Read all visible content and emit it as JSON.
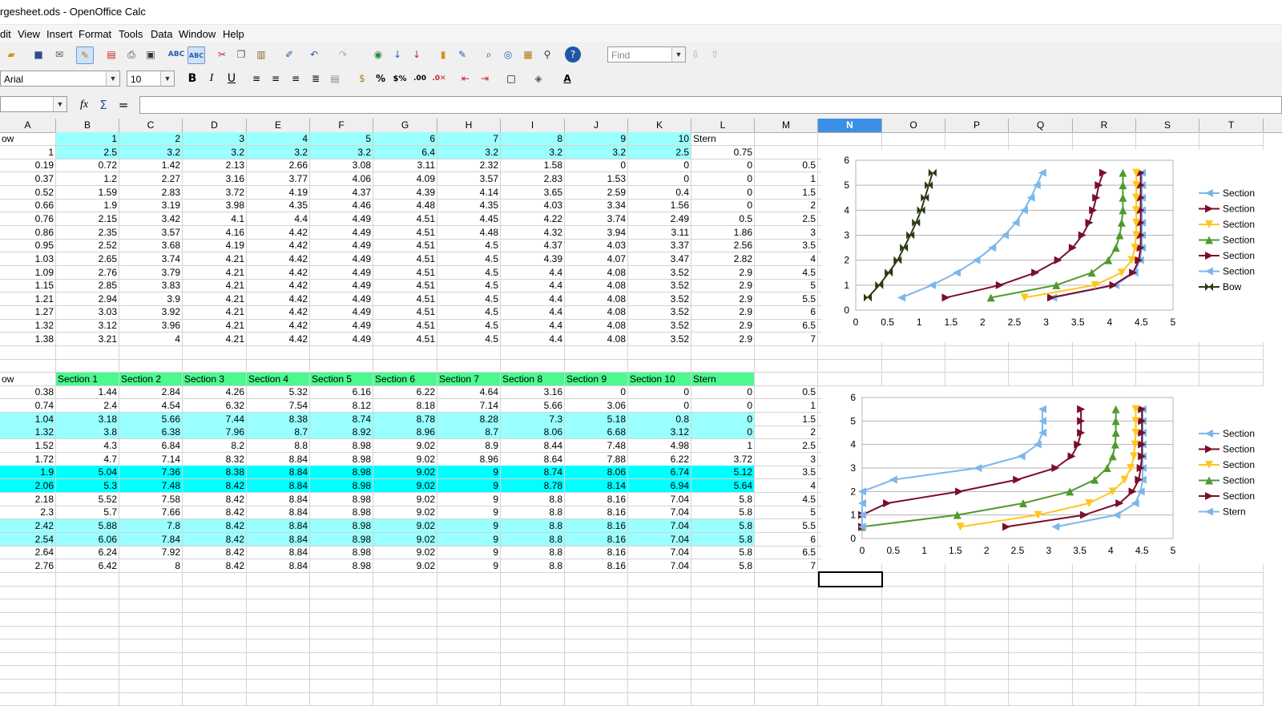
{
  "window": {
    "title": "rgesheet.ods - OpenOffice Calc"
  },
  "menu": [
    "dit",
    "View",
    "Insert",
    "Format",
    "Tools",
    "Data",
    "Window",
    "Help"
  ],
  "toolbar": {
    "find_placeholder": "Find",
    "font_name": "Arial",
    "font_size": "10",
    "icons": [
      "open-icon",
      "save-icon",
      "email-icon",
      "edit-icon",
      "pdf-icon",
      "print-icon",
      "preview-icon",
      "spellcheck-icon",
      "autospell-icon",
      "cut-icon",
      "copy-icon",
      "paste-icon",
      "clone-icon",
      "undo-icon",
      "redo-icon",
      "navigator-icon",
      "sort-asc-icon",
      "sort-desc-icon",
      "chart-icon",
      "draw-icon",
      "find-icon",
      "gallery-icon",
      "datasource-icon",
      "zoom-icon",
      "help-icon"
    ],
    "format_icons": [
      "bold-icon",
      "italic-icon",
      "underline-icon",
      "align-left-icon",
      "align-center-icon",
      "align-right-icon",
      "justify-icon",
      "merge-icon",
      "currency-icon",
      "percent-icon",
      "number-icon",
      "add-decimal-icon",
      "delete-decimal-icon",
      "decrease-indent-icon",
      "increase-indent-icon",
      "border-icon",
      "background-icon",
      "font-color-icon"
    ]
  },
  "formula_bar": {
    "name_box": "",
    "content": ""
  },
  "columns": [
    "A",
    "B",
    "C",
    "D",
    "E",
    "F",
    "G",
    "H",
    "I",
    "J",
    "K",
    "L",
    "M",
    "N",
    "O",
    "P",
    "Q",
    "R",
    "S",
    "T"
  ],
  "selected_column": "N",
  "table1": {
    "header": [
      "ow",
      "1",
      "2",
      "3",
      "4",
      "5",
      "6",
      "7",
      "8",
      "9",
      "10",
      "Stern"
    ],
    "row1": [
      "1",
      "2.5",
      "3.2",
      "3.2",
      "3.2",
      "3.2",
      "6.4",
      "3.2",
      "3.2",
      "3.2",
      "2.5",
      "0.75"
    ],
    "rows": [
      [
        "0.19",
        "0.72",
        "1.42",
        "2.13",
        "2.66",
        "3.08",
        "3.11",
        "2.32",
        "1.58",
        "0",
        "0",
        "0",
        "0.5"
      ],
      [
        "0.37",
        "1.2",
        "2.27",
        "3.16",
        "3.77",
        "4.06",
        "4.09",
        "3.57",
        "2.83",
        "1.53",
        "0",
        "0",
        "1"
      ],
      [
        "0.52",
        "1.59",
        "2.83",
        "3.72",
        "4.19",
        "4.37",
        "4.39",
        "4.14",
        "3.65",
        "2.59",
        "0.4",
        "0",
        "1.5"
      ],
      [
        "0.66",
        "1.9",
        "3.19",
        "3.98",
        "4.35",
        "4.46",
        "4.48",
        "4.35",
        "4.03",
        "3.34",
        "1.56",
        "0",
        "2"
      ],
      [
        "0.76",
        "2.15",
        "3.42",
        "4.1",
        "4.4",
        "4.49",
        "4.51",
        "4.45",
        "4.22",
        "3.74",
        "2.49",
        "0.5",
        "2.5"
      ],
      [
        "0.86",
        "2.35",
        "3.57",
        "4.16",
        "4.42",
        "4.49",
        "4.51",
        "4.48",
        "4.32",
        "3.94",
        "3.11",
        "1.86",
        "3"
      ],
      [
        "0.95",
        "2.52",
        "3.68",
        "4.19",
        "4.42",
        "4.49",
        "4.51",
        "4.5",
        "4.37",
        "4.03",
        "3.37",
        "2.56",
        "3.5"
      ],
      [
        "1.03",
        "2.65",
        "3.74",
        "4.21",
        "4.42",
        "4.49",
        "4.51",
        "4.5",
        "4.39",
        "4.07",
        "3.47",
        "2.82",
        "4"
      ],
      [
        "1.09",
        "2.76",
        "3.79",
        "4.21",
        "4.42",
        "4.49",
        "4.51",
        "4.5",
        "4.4",
        "4.08",
        "3.52",
        "2.9",
        "4.5"
      ],
      [
        "1.15",
        "2.85",
        "3.83",
        "4.21",
        "4.42",
        "4.49",
        "4.51",
        "4.5",
        "4.4",
        "4.08",
        "3.52",
        "2.9",
        "5"
      ],
      [
        "1.21",
        "2.94",
        "3.9",
        "4.21",
        "4.42",
        "4.49",
        "4.51",
        "4.5",
        "4.4",
        "4.08",
        "3.52",
        "2.9",
        "5.5"
      ],
      [
        "1.27",
        "3.03",
        "3.92",
        "4.21",
        "4.42",
        "4.49",
        "4.51",
        "4.5",
        "4.4",
        "4.08",
        "3.52",
        "2.9",
        "6"
      ],
      [
        "1.32",
        "3.12",
        "3.96",
        "4.21",
        "4.42",
        "4.49",
        "4.51",
        "4.5",
        "4.4",
        "4.08",
        "3.52",
        "2.9",
        "6.5"
      ],
      [
        "1.38",
        "3.21",
        "4",
        "4.21",
        "4.42",
        "4.49",
        "4.51",
        "4.5",
        "4.4",
        "4.08",
        "3.52",
        "2.9",
        "7"
      ]
    ]
  },
  "table2": {
    "header": [
      "ow",
      "Section 1",
      "Section 2",
      "Section 3",
      "Section 4",
      "Section 5",
      "Section 6",
      "Section 7",
      "Section 8",
      "Section 9",
      "Section 10",
      "Stern"
    ],
    "rows": [
      [
        "0.38",
        "1.44",
        "2.84",
        "4.26",
        "5.32",
        "6.16",
        "6.22",
        "4.64",
        "3.16",
        "0",
        "0",
        "0",
        "0.5"
      ],
      [
        "0.74",
        "2.4",
        "4.54",
        "6.32",
        "7.54",
        "8.12",
        "8.18",
        "7.14",
        "5.66",
        "3.06",
        "0",
        "0",
        "1"
      ],
      [
        "1.04",
        "3.18",
        "5.66",
        "7.44",
        "8.38",
        "8.74",
        "8.78",
        "8.28",
        "7.3",
        "5.18",
        "0.8",
        "0",
        "1.5"
      ],
      [
        "1.32",
        "3.8",
        "6.38",
        "7.96",
        "8.7",
        "8.92",
        "8.96",
        "8.7",
        "8.06",
        "6.68",
        "3.12",
        "0",
        "2"
      ],
      [
        "1.52",
        "4.3",
        "6.84",
        "8.2",
        "8.8",
        "8.98",
        "9.02",
        "8.9",
        "8.44",
        "7.48",
        "4.98",
        "1",
        "2.5"
      ],
      [
        "1.72",
        "4.7",
        "7.14",
        "8.32",
        "8.84",
        "8.98",
        "9.02",
        "8.96",
        "8.64",
        "7.88",
        "6.22",
        "3.72",
        "3"
      ],
      [
        "1.9",
        "5.04",
        "7.36",
        "8.38",
        "8.84",
        "8.98",
        "9.02",
        "9",
        "8.74",
        "8.06",
        "6.74",
        "5.12",
        "3.5"
      ],
      [
        "2.06",
        "5.3",
        "7.48",
        "8.42",
        "8.84",
        "8.98",
        "9.02",
        "9",
        "8.78",
        "8.14",
        "6.94",
        "5.64",
        "4"
      ],
      [
        "2.18",
        "5.52",
        "7.58",
        "8.42",
        "8.84",
        "8.98",
        "9.02",
        "9",
        "8.8",
        "8.16",
        "7.04",
        "5.8",
        "4.5"
      ],
      [
        "2.3",
        "5.7",
        "7.66",
        "8.42",
        "8.84",
        "8.98",
        "9.02",
        "9",
        "8.8",
        "8.16",
        "7.04",
        "5.8",
        "5"
      ],
      [
        "2.42",
        "5.88",
        "7.8",
        "8.42",
        "8.84",
        "8.98",
        "9.02",
        "9",
        "8.8",
        "8.16",
        "7.04",
        "5.8",
        "5.5"
      ],
      [
        "2.54",
        "6.06",
        "7.84",
        "8.42",
        "8.84",
        "8.98",
        "9.02",
        "9",
        "8.8",
        "8.16",
        "7.04",
        "5.8",
        "6"
      ],
      [
        "2.64",
        "6.24",
        "7.92",
        "8.42",
        "8.84",
        "8.98",
        "9.02",
        "9",
        "8.8",
        "8.16",
        "7.04",
        "5.8",
        "6.5"
      ],
      [
        "2.76",
        "6.42",
        "8",
        "8.42",
        "8.84",
        "8.98",
        "9.02",
        "9",
        "8.8",
        "8.16",
        "7.04",
        "5.8",
        "7"
      ]
    ],
    "row_highlight": [
      "none",
      "none",
      "cyan",
      "cyan",
      "none",
      "none",
      "strong",
      "strong",
      "none",
      "none",
      "cyan",
      "cyan",
      "none",
      "none"
    ]
  },
  "chart_data": [
    {
      "type": "scatter",
      "xlim": [
        0,
        5
      ],
      "ylim": [
        0,
        6
      ],
      "xticks": [
        "0",
        "0.5",
        "1",
        "1.5",
        "2",
        "2.5",
        "3",
        "3.5",
        "4",
        "4.5",
        "5"
      ],
      "yticks": [
        "0",
        "1",
        "2",
        "3",
        "4",
        "5",
        "6"
      ],
      "y": [
        0.5,
        1,
        1.5,
        2,
        2.5,
        3,
        3.5,
        4,
        4.5,
        5,
        5.5
      ],
      "series": [
        {
          "name": "Section",
          "color": "#7cb7ea",
          "marker": "left-triangle",
          "values": [
            3.11,
            4.09,
            4.39,
            4.48,
            4.51,
            4.51,
            4.51,
            4.51,
            4.51,
            4.51,
            4.51
          ]
        },
        {
          "name": "Section",
          "color": "#7a0e2a",
          "marker": "right-triangle",
          "values": [
            3.08,
            4.06,
            4.37,
            4.46,
            4.49,
            4.49,
            4.49,
            4.49,
            4.49,
            4.49,
            4.49
          ]
        },
        {
          "name": "Section",
          "color": "#ffc61e",
          "marker": "down-triangle",
          "values": [
            2.66,
            3.77,
            4.19,
            4.35,
            4.4,
            4.42,
            4.42,
            4.42,
            4.42,
            4.42,
            4.42
          ]
        },
        {
          "name": "Section",
          "color": "#4f9a2f",
          "marker": "up-triangle",
          "values": [
            2.13,
            3.16,
            3.72,
            3.98,
            4.1,
            4.16,
            4.19,
            4.21,
            4.21,
            4.21,
            4.21
          ]
        },
        {
          "name": "Section",
          "color": "#7a0e2a",
          "marker": "right-triangle",
          "values": [
            1.42,
            2.27,
            2.83,
            3.19,
            3.42,
            3.57,
            3.68,
            3.74,
            3.79,
            3.83,
            3.9
          ]
        },
        {
          "name": "Section",
          "color": "#7cb7ea",
          "marker": "left-triangle",
          "values": [
            0.72,
            1.2,
            1.59,
            1.9,
            2.15,
            2.35,
            2.52,
            2.65,
            2.76,
            2.85,
            2.94
          ]
        },
        {
          "name": "Bow",
          "color": "#2a3a12",
          "marker": "bowtie",
          "values": [
            0.19,
            0.37,
            0.52,
            0.66,
            0.76,
            0.86,
            0.95,
            1.03,
            1.09,
            1.15,
            1.21
          ]
        }
      ]
    },
    {
      "type": "scatter",
      "xlim": [
        0,
        5
      ],
      "ylim": [
        0,
        6
      ],
      "xticks": [
        "0",
        "0.5",
        "1",
        "1.5",
        "2",
        "2.5",
        "3",
        "3.5",
        "4",
        "4.5",
        "5"
      ],
      "yticks": [
        "0",
        "1",
        "2",
        "3",
        "4",
        "5",
        "6"
      ],
      "y": [
        0.5,
        1,
        1.5,
        2,
        2.5,
        3,
        3.5,
        4,
        4.5,
        5,
        5.5
      ],
      "series": [
        {
          "name": "Section",
          "color": "#7cb7ea",
          "marker": "left-triangle",
          "values": [
            3.11,
            4.09,
            4.39,
            4.48,
            4.51,
            4.51,
            4.51,
            4.51,
            4.51,
            4.51,
            4.51
          ]
        },
        {
          "name": "Section",
          "color": "#7a0e2a",
          "marker": "right-triangle",
          "values": [
            2.32,
            3.57,
            4.14,
            4.35,
            4.45,
            4.48,
            4.5,
            4.5,
            4.5,
            4.5,
            4.5
          ]
        },
        {
          "name": "Section",
          "color": "#ffc61e",
          "marker": "down-triangle",
          "values": [
            1.58,
            2.83,
            3.65,
            4.03,
            4.22,
            4.32,
            4.37,
            4.39,
            4.4,
            4.4,
            4.4
          ]
        },
        {
          "name": "Section",
          "color": "#4f9a2f",
          "marker": "up-triangle",
          "values": [
            0,
            1.53,
            2.59,
            3.34,
            3.74,
            3.94,
            4.03,
            4.07,
            4.08,
            4.08,
            4.08
          ]
        },
        {
          "name": "Section",
          "color": "#7a0e2a",
          "marker": "right-triangle",
          "values": [
            0,
            0,
            0.4,
            1.56,
            2.49,
            3.11,
            3.37,
            3.47,
            3.52,
            3.52,
            3.52
          ]
        },
        {
          "name": "Stern",
          "color": "#7cb7ea",
          "marker": "left-triangle",
          "values": [
            0,
            0,
            0,
            0,
            0.5,
            1.86,
            2.56,
            2.82,
            2.9,
            2.9,
            2.9
          ]
        }
      ]
    }
  ]
}
